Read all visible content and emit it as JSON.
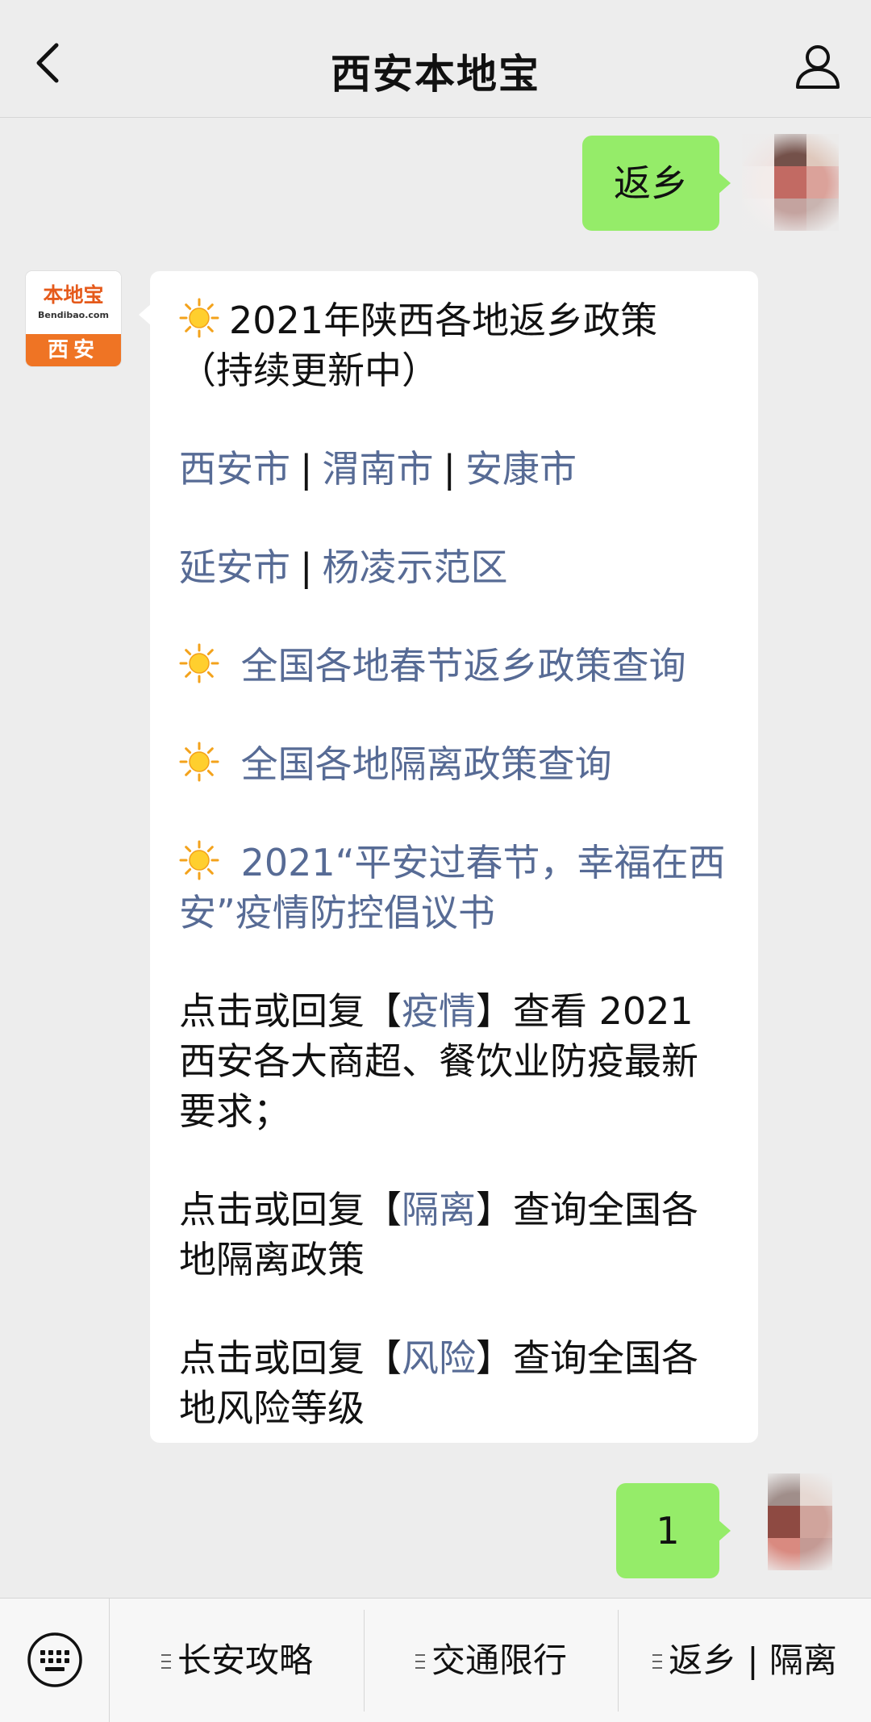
{
  "header": {
    "title": "西安本地宝"
  },
  "messages": {
    "user_first": "返乡",
    "user_second": "1"
  },
  "bot_avatar": {
    "brand": "本地宝",
    "brand_sub": "Bendibao.com",
    "city": "西安"
  },
  "reply": {
    "headline": "2021年陕西各地返乡政策（持续更新中）",
    "cities_row1": [
      "西安市",
      "渭南市",
      "安康市"
    ],
    "cities_row2": [
      "延安市",
      "杨凌示范区"
    ],
    "separator": "|",
    "link_national_return": "全国各地春节返乡政策查询",
    "link_national_quarantine": "全国各地隔离政策查询",
    "link_initiative": "2021“平安过春节，幸福在西安”疫情防控倡议书",
    "tip1": {
      "before": "点击或回复【",
      "keyword": "疫情",
      "after": "】查看 2021 西安各大商超、餐饮业防疫最新要求；"
    },
    "tip2": {
      "before": "点击或回复【",
      "keyword": "隔离",
      "after": "】查询全国各地隔离政策"
    },
    "tip3": {
      "before": "点击或回复【",
      "keyword": "风险",
      "after": "】查询全国各地风险等级"
    }
  },
  "menu": {
    "items": [
      "长安攻略",
      "交通限行",
      "返乡 | 隔离"
    ]
  },
  "colors": {
    "background": "#ededed",
    "user_bubble": "#95ec69",
    "link": "#576b95",
    "brand_orange": "#ef7424"
  }
}
